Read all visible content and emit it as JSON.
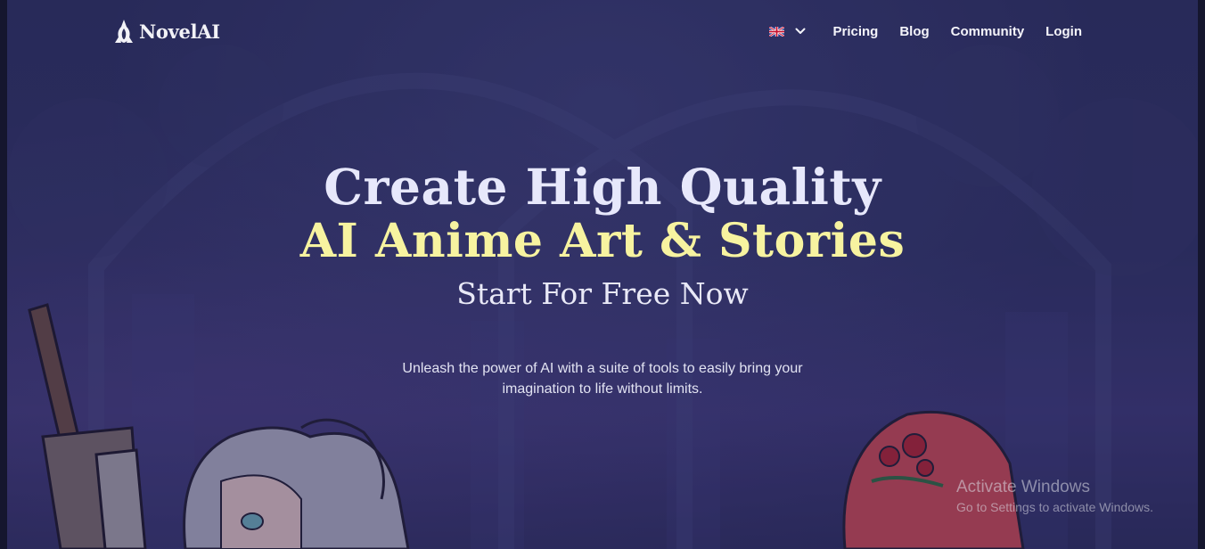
{
  "nav": {
    "logo_text": "NovelAI",
    "links": [
      {
        "label": "Pricing"
      },
      {
        "label": "Blog"
      },
      {
        "label": "Community"
      },
      {
        "label": "Login"
      }
    ]
  },
  "hero": {
    "line1": "Create High Quality",
    "line2": "AI Anime Art & Stories",
    "subtitle": "Start For Free Now",
    "description": "Unleash the power of AI with a suite of tools to easily bring your imagination to life without limits."
  },
  "watermark": {
    "title": "Activate Windows",
    "subtitle": "Go to Settings to activate Windows."
  },
  "colors": {
    "background": "#2c2f5e",
    "heading": "#e7e8fb",
    "accent_heading": "#f7f3a0",
    "text": "#e2e3f2"
  },
  "icons": {
    "logo": "novelai-logo-icon",
    "language": "uk-flag-icon",
    "dropdown": "chevron-down-icon"
  }
}
